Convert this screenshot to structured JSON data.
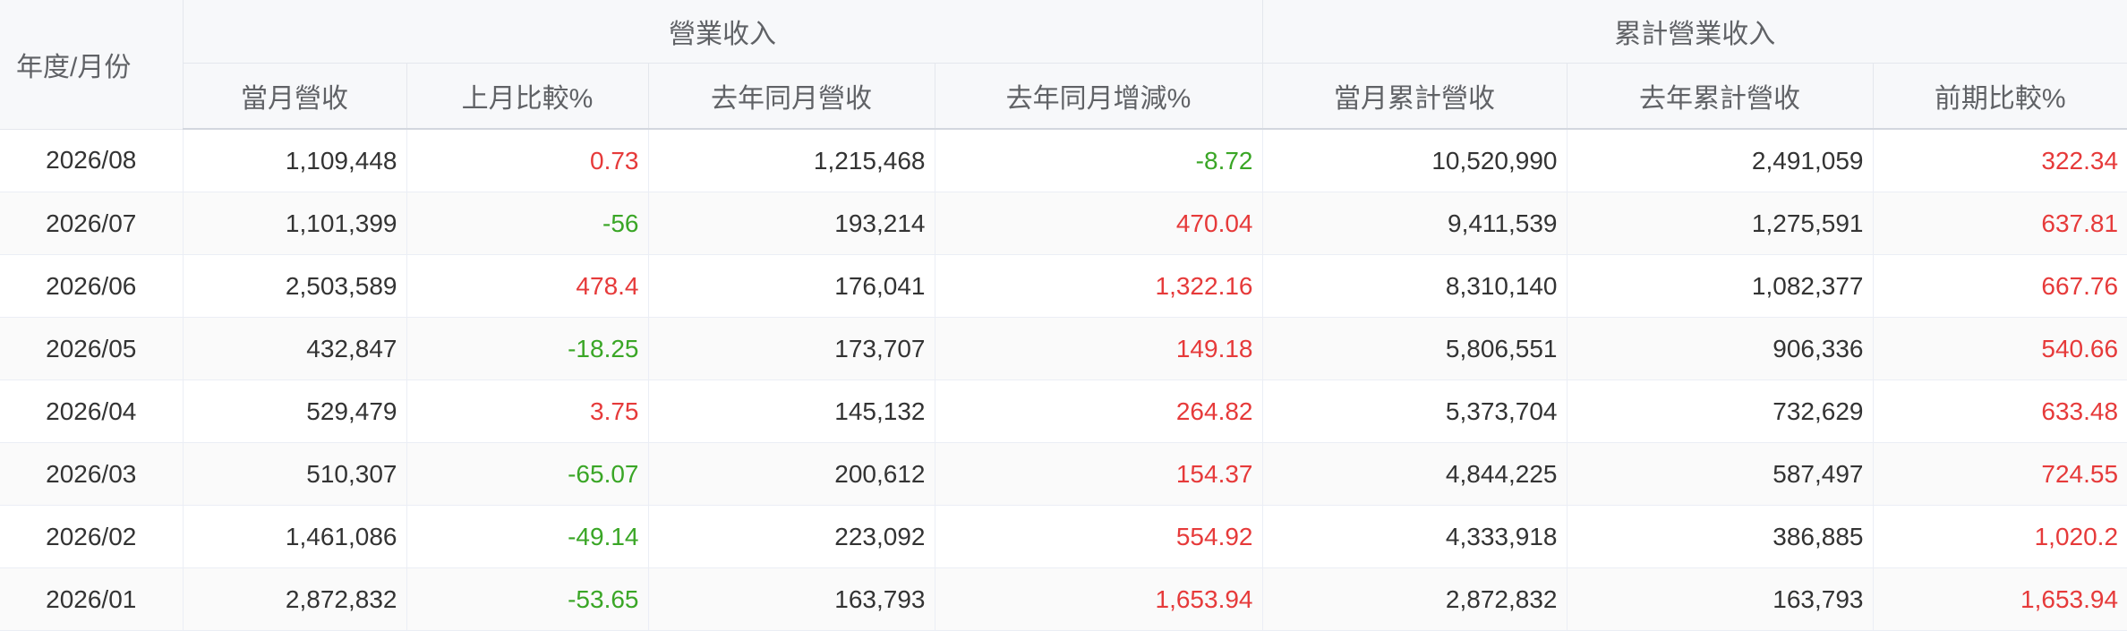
{
  "header": {
    "period_label": "年度/月份",
    "group_monthly": "營業收入",
    "group_cumulative": "累計營業收入",
    "columns": [
      "當月營收",
      "上月比較%",
      "去年同月營收",
      "去年同月增減%",
      "當月累計營收",
      "去年累計營收",
      "前期比較%"
    ]
  },
  "colors": {
    "positive": "#e63a3a",
    "negative": "#3aa626"
  },
  "rows": [
    {
      "period": "2026/08",
      "monthly": "1,109,448",
      "mom": "0.73",
      "last_year_monthly": "1,215,468",
      "yoy": "-8.72",
      "cumulative": "10,520,990",
      "last_year_cumulative": "2,491,059",
      "cum_change": "322.34"
    },
    {
      "period": "2026/07",
      "monthly": "1,101,399",
      "mom": "-56",
      "last_year_monthly": "193,214",
      "yoy": "470.04",
      "cumulative": "9,411,539",
      "last_year_cumulative": "1,275,591",
      "cum_change": "637.81"
    },
    {
      "period": "2026/06",
      "monthly": "2,503,589",
      "mom": "478.4",
      "last_year_monthly": "176,041",
      "yoy": "1,322.16",
      "cumulative": "8,310,140",
      "last_year_cumulative": "1,082,377",
      "cum_change": "667.76"
    },
    {
      "period": "2026/05",
      "monthly": "432,847",
      "mom": "-18.25",
      "last_year_monthly": "173,707",
      "yoy": "149.18",
      "cumulative": "5,806,551",
      "last_year_cumulative": "906,336",
      "cum_change": "540.66"
    },
    {
      "period": "2026/04",
      "monthly": "529,479",
      "mom": "3.75",
      "last_year_monthly": "145,132",
      "yoy": "264.82",
      "cumulative": "5,373,704",
      "last_year_cumulative": "732,629",
      "cum_change": "633.48"
    },
    {
      "period": "2026/03",
      "monthly": "510,307",
      "mom": "-65.07",
      "last_year_monthly": "200,612",
      "yoy": "154.37",
      "cumulative": "4,844,225",
      "last_year_cumulative": "587,497",
      "cum_change": "724.55"
    },
    {
      "period": "2026/02",
      "monthly": "1,461,086",
      "mom": "-49.14",
      "last_year_monthly": "223,092",
      "yoy": "554.92",
      "cumulative": "4,333,918",
      "last_year_cumulative": "386,885",
      "cum_change": "1,020.2"
    },
    {
      "period": "2026/01",
      "monthly": "2,872,832",
      "mom": "-53.65",
      "last_year_monthly": "163,793",
      "yoy": "1,653.94",
      "cumulative": "2,872,832",
      "last_year_cumulative": "163,793",
      "cum_change": "1,653.94"
    }
  ]
}
